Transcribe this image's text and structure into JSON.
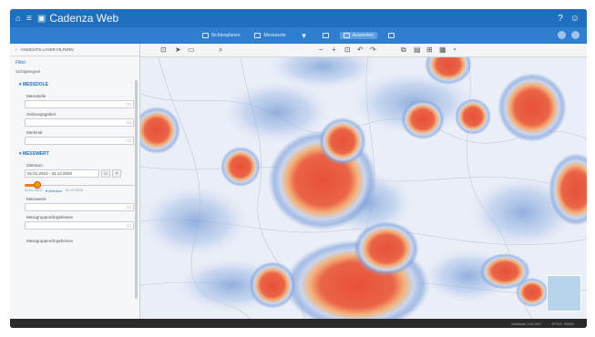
{
  "window": {
    "title": "Cadenza Web"
  },
  "toolbar": {
    "buttons": [
      {
        "label": "Sichtenplanen",
        "active": false
      },
      {
        "label": "Messwerte",
        "active": false
      },
      {
        "label": "Auswerten",
        "active": true
      }
    ]
  },
  "sidebar": {
    "header": "ANSICHTS LAYER FILTERN",
    "filter_title": "Filter",
    "filter_sub": "Sichtgeeignet",
    "sections": [
      {
        "title": "▾ MESSDOLE",
        "fields": [
          "Messstelle",
          "Ordnungsgebiet",
          "Merkmal"
        ]
      },
      {
        "title": "▾ MESSWERT",
        "fields": []
      }
    ],
    "date_label": "Zeitraum",
    "date_value": "01.01.2010 - 31.12.2020",
    "slider": {
      "level": 0.1,
      "labels": [
        "01.01.2010",
        "▾ Zeitraum",
        "31.12.2020"
      ]
    },
    "more_fields": [
      "Messwerte",
      "Messgruppen/Ergebnisse"
    ],
    "bottom_label": "Messgruppen/Ergebnisse"
  },
  "status": {
    "left": "Maßstab 1:50.000",
    "right": "EPSG: 25832"
  },
  "colors": {
    "brand": "#1f6fbf",
    "heat_hot": "#e8503a",
    "heat_warm": "#f5c08a",
    "heat_cool": "#9cb8e4"
  }
}
